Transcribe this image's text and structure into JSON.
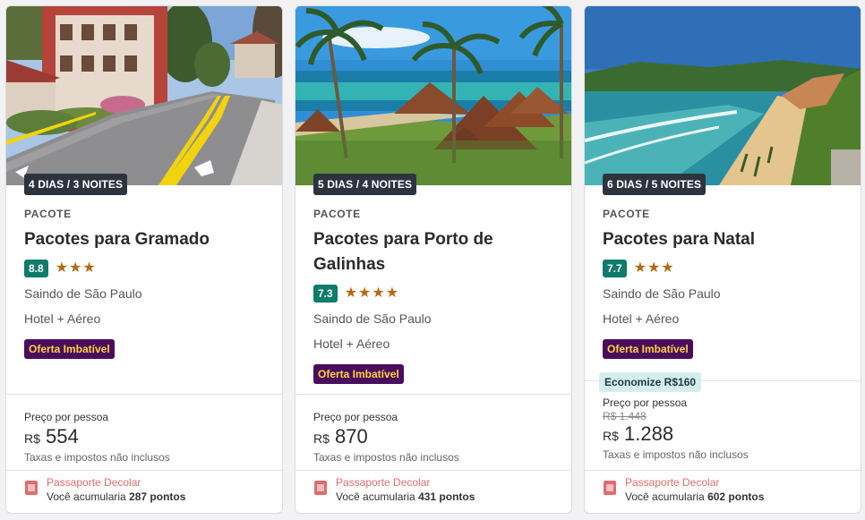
{
  "cards": [
    {
      "duration": "4 DIAS / 3 NOITES",
      "kind": "PACOTE",
      "title": "Pacotes para Gramado",
      "score": "8.8",
      "stars": "★★★",
      "origin": "Saindo de São Paulo",
      "includes": "Hotel + Aéreo",
      "offer": "Oferta Imbatível",
      "price_label": "Preço por pessoa",
      "currency": "R$",
      "price": "554",
      "taxes": "Taxas e impostos não inclusos",
      "passport_title": "Passaporte Decolar",
      "points_prefix": "Você acumularia",
      "points": "287 pontos"
    },
    {
      "duration": "5 DIAS / 4 NOITES",
      "kind": "PACOTE",
      "title": "Pacotes para Porto de Galinhas",
      "score": "7.3",
      "stars": "★★★★",
      "origin": "Saindo de São Paulo",
      "includes": "Hotel + Aéreo",
      "offer": "Oferta Imbatível",
      "price_label": "Preço por pessoa",
      "currency": "R$",
      "price": "870",
      "taxes": "Taxas e impostos não inclusos",
      "passport_title": "Passaporte Decolar",
      "points_prefix": "Você acumularia",
      "points": "431 pontos"
    },
    {
      "duration": "6 DIAS / 5 NOITES",
      "kind": "PACOTE",
      "title": "Pacotes para Natal",
      "score": "7.7",
      "stars": "★★★",
      "origin": "Saindo de São Paulo",
      "includes": "Hotel + Aéreo",
      "offer": "Oferta Imbatível",
      "savings": "Economize R$160",
      "price_label": "Preço por pessoa",
      "old_price": "R$ 1.448",
      "currency": "R$",
      "price": "1.288",
      "taxes": "Taxas e impostos não inclusos",
      "passport_title": "Passaporte Decolar",
      "points_prefix": "Você acumularia",
      "points": "602 pontos"
    }
  ],
  "colors": {
    "score_bg": "#0f7b6b",
    "offer_bg": "#4a0d5e",
    "offer_text": "#ffd23c",
    "star": "#b66a12",
    "passport": "#e26b6b",
    "savings_bg": "#d4eeef"
  }
}
